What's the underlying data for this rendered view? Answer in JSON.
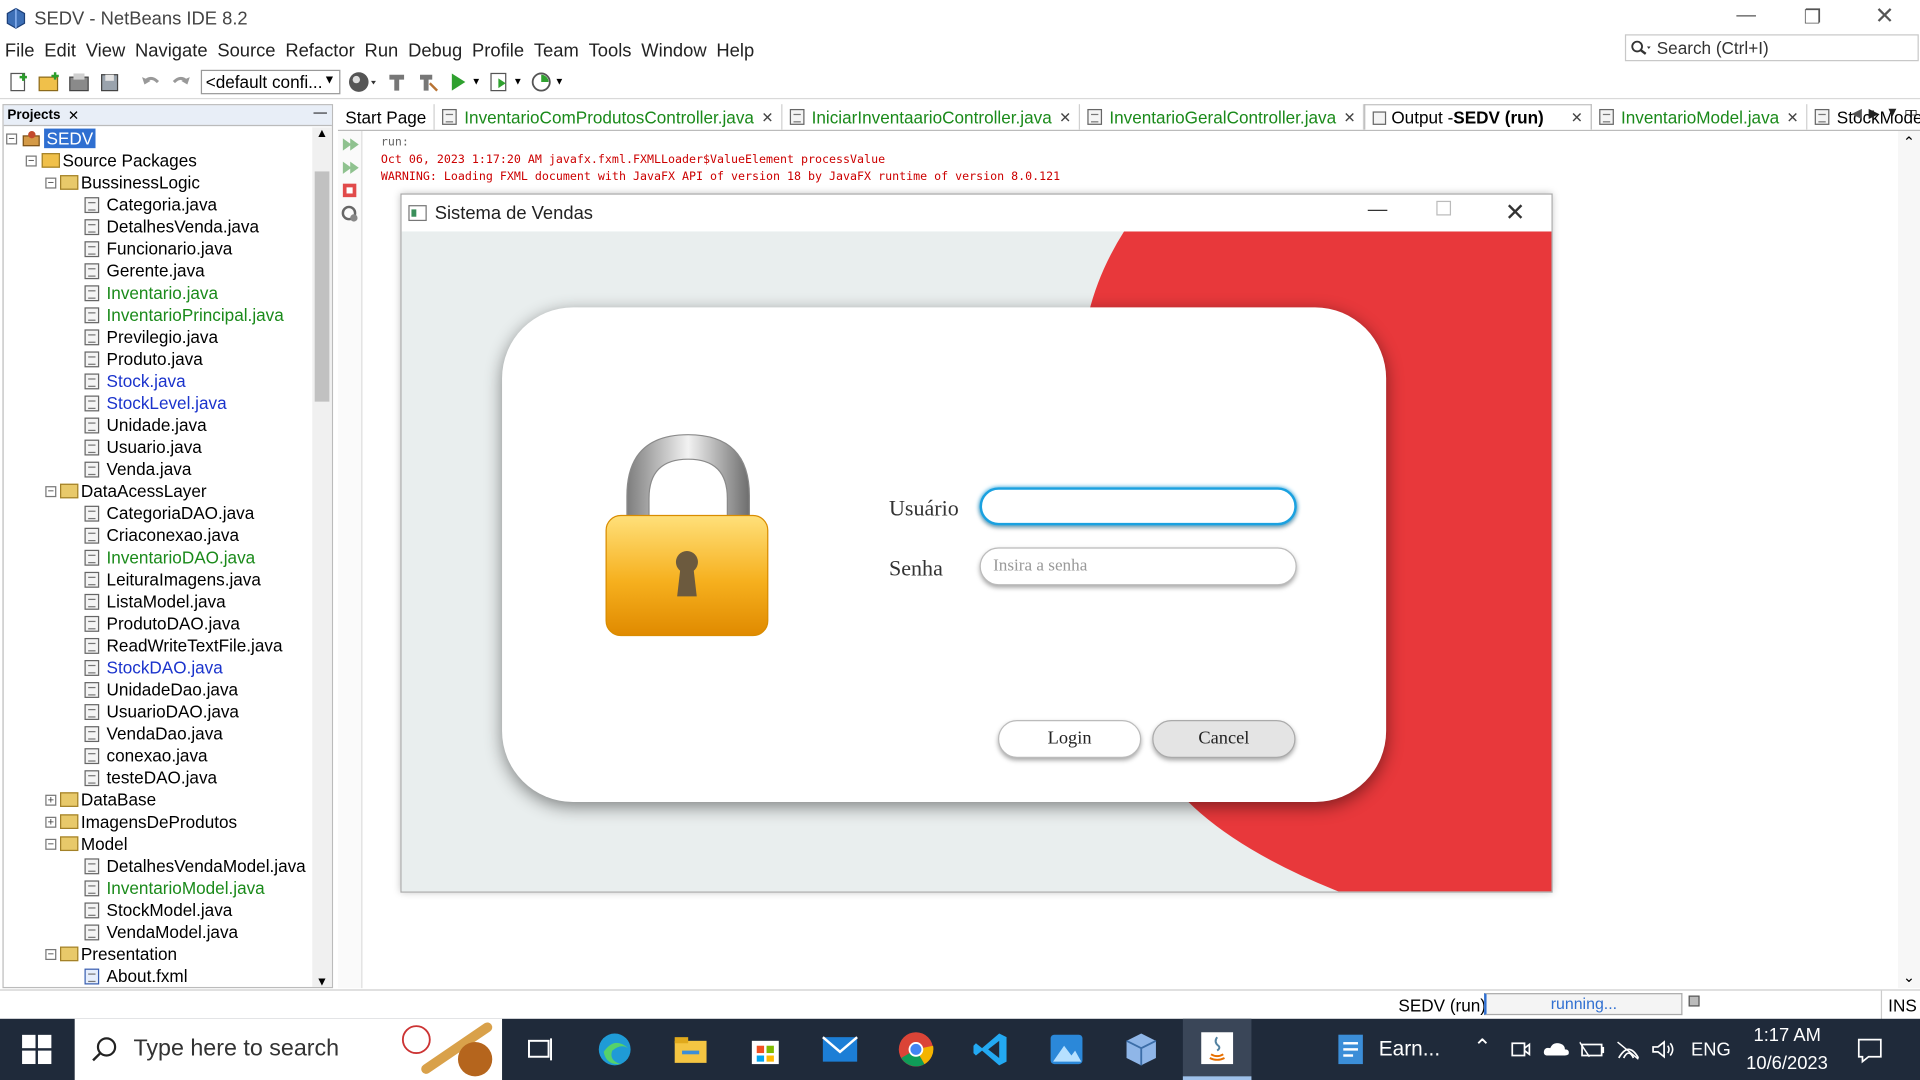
{
  "window": {
    "title": "SEDV - NetBeans IDE 8.2"
  },
  "menu": [
    "File",
    "Edit",
    "View",
    "Navigate",
    "Source",
    "Refactor",
    "Run",
    "Debug",
    "Profile",
    "Team",
    "Tools",
    "Window",
    "Help"
  ],
  "search": {
    "placeholder": "Search (Ctrl+I)"
  },
  "toolbar": {
    "config": "<default confi..."
  },
  "projects": {
    "tab": "Projects",
    "root": "SEDV",
    "source_packages": "Source Packages",
    "items": [
      {
        "label": "BussinessLogic",
        "type": "package",
        "level": 2,
        "toggle": "−",
        "color": "normal"
      },
      {
        "label": "Categoria.java",
        "type": "file",
        "level": 3,
        "color": "normal"
      },
      {
        "label": "DetalhesVenda.java",
        "type": "file",
        "level": 3,
        "color": "normal"
      },
      {
        "label": "Funcionario.java",
        "type": "file",
        "level": 3,
        "color": "normal"
      },
      {
        "label": "Gerente.java",
        "type": "file",
        "level": 3,
        "color": "normal"
      },
      {
        "label": "Inventario.java",
        "type": "file",
        "level": 3,
        "color": "green"
      },
      {
        "label": "InventarioPrincipal.java",
        "type": "file",
        "level": 3,
        "color": "green"
      },
      {
        "label": "Previlegio.java",
        "type": "file",
        "level": 3,
        "color": "normal"
      },
      {
        "label": "Produto.java",
        "type": "file",
        "level": 3,
        "color": "normal"
      },
      {
        "label": "Stock.java",
        "type": "file",
        "level": 3,
        "color": "blue"
      },
      {
        "label": "StockLevel.java",
        "type": "file",
        "level": 3,
        "color": "blue"
      },
      {
        "label": "Unidade.java",
        "type": "file",
        "level": 3,
        "color": "normal"
      },
      {
        "label": "Usuario.java",
        "type": "file",
        "level": 3,
        "color": "normal"
      },
      {
        "label": "Venda.java",
        "type": "file",
        "level": 3,
        "color": "normal"
      },
      {
        "label": "DataAcessLayer",
        "type": "package",
        "level": 2,
        "toggle": "−",
        "color": "normal"
      },
      {
        "label": "CategoriaDAO.java",
        "type": "file",
        "level": 3,
        "color": "normal"
      },
      {
        "label": "Criaconexao.java",
        "type": "file",
        "level": 3,
        "color": "normal"
      },
      {
        "label": "InventarioDAO.java",
        "type": "file",
        "level": 3,
        "color": "green"
      },
      {
        "label": "LeituraImagens.java",
        "type": "file",
        "level": 3,
        "color": "normal"
      },
      {
        "label": "ListaModel.java",
        "type": "file",
        "level": 3,
        "color": "normal"
      },
      {
        "label": "ProdutoDAO.java",
        "type": "file",
        "level": 3,
        "color": "normal"
      },
      {
        "label": "ReadWriteTextFile.java",
        "type": "file",
        "level": 3,
        "color": "normal"
      },
      {
        "label": "StockDAO.java",
        "type": "file",
        "level": 3,
        "color": "blue"
      },
      {
        "label": "UnidadeDao.java",
        "type": "file",
        "level": 3,
        "color": "normal"
      },
      {
        "label": "UsuarioDAO.java",
        "type": "file",
        "level": 3,
        "color": "normal"
      },
      {
        "label": "VendaDao.java",
        "type": "file",
        "level": 3,
        "color": "normal"
      },
      {
        "label": "conexao.java",
        "type": "file",
        "level": 3,
        "color": "normal"
      },
      {
        "label": "testeDAO.java",
        "type": "file",
        "level": 3,
        "color": "normal"
      },
      {
        "label": "DataBase",
        "type": "package",
        "level": 2,
        "toggle": "+",
        "color": "normal"
      },
      {
        "label": "ImagensDeProdutos",
        "type": "package",
        "level": 2,
        "toggle": "+",
        "color": "normal"
      },
      {
        "label": "Model",
        "type": "package",
        "level": 2,
        "toggle": "−",
        "color": "normal"
      },
      {
        "label": "DetalhesVendaModel.java",
        "type": "file",
        "level": 3,
        "color": "normal"
      },
      {
        "label": "InventarioModel.java",
        "type": "file",
        "level": 3,
        "color": "green"
      },
      {
        "label": "StockModel.java",
        "type": "file",
        "level": 3,
        "color": "normal"
      },
      {
        "label": "VendaModel.java",
        "type": "file",
        "level": 3,
        "color": "normal"
      },
      {
        "label": "Presentation",
        "type": "package",
        "level": 2,
        "toggle": "−",
        "color": "normal"
      },
      {
        "label": "About.fxml",
        "type": "fxml",
        "level": 3,
        "color": "normal"
      }
    ]
  },
  "editor_tabs": [
    {
      "label": "Start Page",
      "style": "plain",
      "close": false
    },
    {
      "label": "InventarioComProdutosController.java",
      "style": "green",
      "close": true
    },
    {
      "label": "IniciarInventaarioController.java",
      "style": "green",
      "close": true
    },
    {
      "label": "InventarioGeralController.java",
      "style": "green",
      "close": true
    },
    {
      "label": "Output - ",
      "bold": "SEDV (run)",
      "style": "active",
      "close": true
    },
    {
      "label": "InventarioModel.java",
      "style": "green",
      "close": true
    },
    {
      "label": "StockModel.ja...",
      "style": "plain",
      "close": false
    }
  ],
  "output": {
    "lines": [
      "run:",
      "Oct 06, 2023 1:17:20 AM javafx.fxml.FXMLLoader$ValueElement processValue",
      "WARNING: Loading FXML document with JavaFX API of version 18 by JavaFX runtime of version 8.0.121"
    ]
  },
  "dialog": {
    "title": "Sistema de Vendas",
    "user_label": "Usuário",
    "user_value": "",
    "password_label": "Senha",
    "password_placeholder": "Insira a senha",
    "login": "Login",
    "cancel": "Cancel",
    "accent": "#e8383b"
  },
  "status": {
    "run": "SEDV (run)",
    "progress": "running...",
    "mode": "INS"
  },
  "taskbar": {
    "search_placeholder": "Type here to search",
    "app_label": "Earn...",
    "lang": "ENG",
    "time": "1:17 AM",
    "date": "10/6/2023"
  }
}
